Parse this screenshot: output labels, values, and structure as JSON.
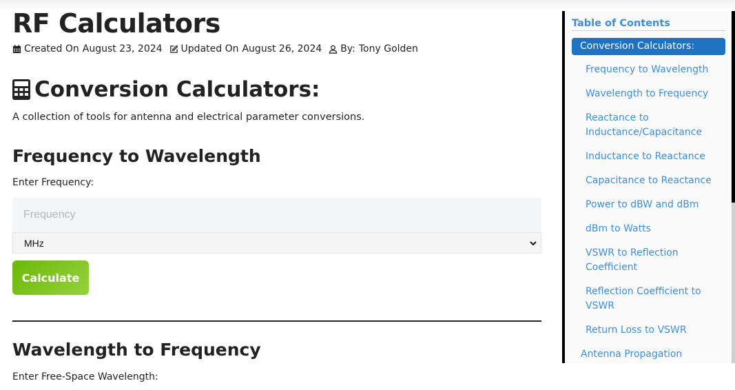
{
  "page": {
    "title": "RF Calculators",
    "meta": {
      "created_label": "Created On",
      "created_date": "August 23, 2024",
      "updated_label": "Updated On",
      "updated_date": "August 26, 2024",
      "author_label": "By:",
      "author": "Tony Golden",
      "icons": [
        "calendar-icon",
        "edit-icon",
        "user-icon"
      ]
    }
  },
  "section": {
    "icon": "calculator-icon",
    "title": "Conversion Calculators:",
    "intro": "A collection of tools for antenna and electrical parameter conversions."
  },
  "calculators": [
    {
      "title": "Frequency to Wavelength",
      "label": "Enter Frequency:",
      "input_placeholder": "Frequency",
      "input_value": "",
      "unit_selected": "MHz",
      "button_label": "Calculate"
    },
    {
      "title": "Wavelength to Frequency",
      "label": "Enter Free-Space Wavelength:"
    }
  ],
  "toc": {
    "title": "Table of Contents",
    "active": "Conversion Calculators:",
    "items": [
      "Frequency to Wavelength",
      "Wavelength to Frequency",
      "Reactance to Inductance/Capacitance",
      "Inductance to Reactance",
      "Capacitance to Reactance",
      "Power to dBW and dBm",
      "dBm to Watts",
      "VSWR to Reflection Coefficient",
      "Reflection Coefficient to VSWR",
      "Return Loss to VSWR"
    ],
    "next_section": "Antenna Propagation"
  },
  "colors": {
    "accent_blue": "#1f72c2",
    "link_blue": "#3b8fdc",
    "button_green": "#7cc21a"
  }
}
